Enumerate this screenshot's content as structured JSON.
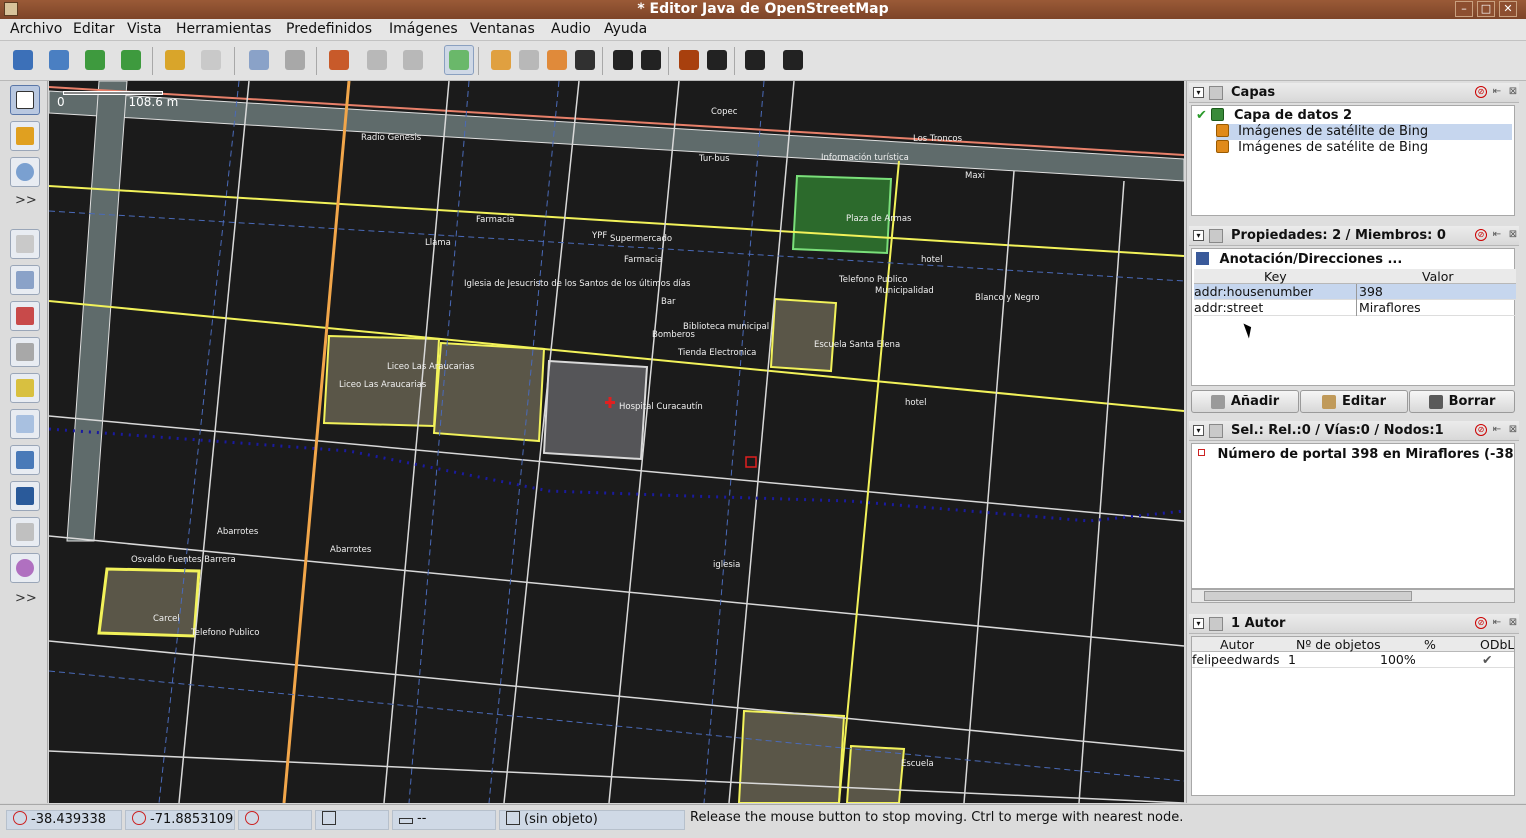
{
  "window": {
    "title": "* Editor Java de OpenStreetMap",
    "controls": [
      "–",
      "□",
      "✕"
    ]
  },
  "menu": [
    "Archivo",
    "Editar",
    "Vista",
    "Herramientas",
    "Predefinidos",
    "Imágenes",
    "Ventanas",
    "Audio",
    "Ayuda"
  ],
  "toolbar_icons": [
    "open-icon",
    "save-icon",
    "download-icon",
    "upload-icon",
    "undo-icon",
    "redo-icon",
    "preferences-icon",
    "wireframe-icon",
    "merge-icon",
    "split-icon",
    "reverse-icon",
    "select-icon",
    "align-icon",
    "orthogonalize-icon",
    "simplify-icon",
    "move-icon",
    "car-icon",
    "bus-icon",
    "warning-icon",
    "delete-icon",
    "castle-icon",
    "factory-icon"
  ],
  "left_tools": {
    "top_more": ">>",
    "bottom_more": ">>",
    "icons": [
      "select-tool-icon",
      "draw-tool-icon",
      "zoom-tool-icon",
      "layers-panel-icon",
      "tags-panel-icon",
      "relation-panel-icon",
      "history-panel-icon",
      "imagery-panel-icon",
      "filter-panel-icon",
      "conflict-panel-icon",
      "validation-panel-icon",
      "funnel-icon",
      "map-paint-icon"
    ]
  },
  "map": {
    "scale_min": "0",
    "scale_max": "108.6 m",
    "labels": [
      "Radio Genesis",
      "Copec",
      "Tur-bus",
      "Información turística",
      "Los Troncos",
      "Maxi",
      "Farmacia",
      "Llama",
      "YPF",
      "Supermercado",
      "Farmacia",
      "Tienda Electronica",
      "Iglesia de Jesucristo de los Santos de los últimos días",
      "Bar",
      "Biblioteca municipal",
      "Bomberos",
      "Liceo Las Araucarias",
      "Liceo Las Araucarias",
      "Hospital Curacautín",
      "Escuela Santa Elena",
      "hotel",
      "hotel",
      "Municipalidad",
      "Telefono Publico",
      "Blanco y Negro",
      "Abarrotes",
      "Abarrotes",
      "Osvaldo Fuentes Barrera",
      "Carcel",
      "Telefono Publico",
      "iglesia",
      "Escuela",
      "Plaza de Armas"
    ]
  },
  "layers_panel": {
    "title": "Capas",
    "items": [
      "Capa de datos 2",
      "Imágenes de satélite de Bing",
      "Imágenes de satélite de Bing"
    ]
  },
  "properties_panel": {
    "title": "Propiedades: 2 / Miembros: 0",
    "subtitle": "Anotación/Direcciones ...",
    "columns": [
      "Key",
      "Valor"
    ],
    "rows": [
      {
        "key": "addr:housenumber",
        "value": "398"
      },
      {
        "key": "addr:street",
        "value": "Miraflores"
      }
    ],
    "buttons": [
      "Añadir",
      "Editar",
      "Borrar"
    ]
  },
  "selection_panel": {
    "title": "Sel.: Rel.:0 / Vías:0 / Nodos:1",
    "item": "Número de portal 398 en Miraflores (-38.43"
  },
  "authors_panel": {
    "title": "1 Autor",
    "columns": [
      "Autor",
      "Nº de objetos",
      "%",
      "ODbL"
    ],
    "rows": [
      {
        "author": "felipeedwards",
        "count": "1",
        "pct": "100%",
        "odbl": "✔"
      }
    ]
  },
  "status": {
    "lat": "-38.439338",
    "lon": "-71.8853109",
    "heading": "",
    "angle": "",
    "distance": "--",
    "object": "(sin objeto)",
    "message": "Release the mouse button to stop moving. Ctrl to merge with nearest node."
  },
  "colors": {
    "titlebar": "#8a4a2c",
    "map_bg": "#1b1b1b",
    "road_yellow": "#f2f25a",
    "road_white": "#d9d9d9",
    "road_orange": "#f2a64a",
    "building": "#5a5648",
    "selection": "#c6d6ee",
    "river_dots": "#1a1aa0"
  }
}
